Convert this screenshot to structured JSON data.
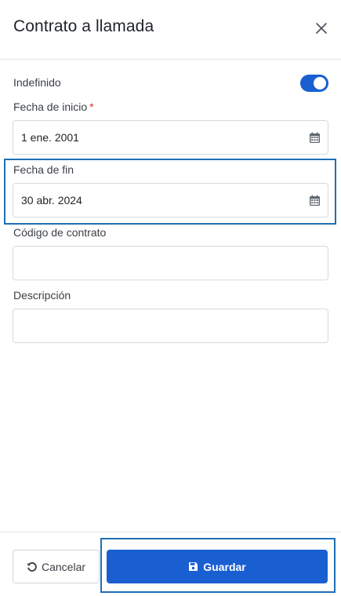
{
  "dialog": {
    "title": "Contrato a llamada"
  },
  "form": {
    "indefinido": {
      "label": "Indefinido",
      "checked": true
    },
    "fecha_inicio": {
      "label": "Fecha de inicio",
      "required_mark": "*",
      "value": "1 ene. 2001"
    },
    "fecha_fin": {
      "label": "Fecha de fin",
      "value": "30 abr. 2024"
    },
    "codigo_contrato": {
      "label": "Código de contrato",
      "value": ""
    },
    "descripcion": {
      "label": "Descripción",
      "value": ""
    }
  },
  "footer": {
    "cancel_label": "Cancelar",
    "save_label": "Guardar"
  },
  "icons": {
    "close": "close-icon",
    "calendar": "calendar-icon",
    "undo": "undo-icon",
    "save": "floppy-disk-icon"
  },
  "colors": {
    "primary": "#1a5fd1",
    "highlight": "#1f6fb5",
    "required": "#d9342b"
  }
}
